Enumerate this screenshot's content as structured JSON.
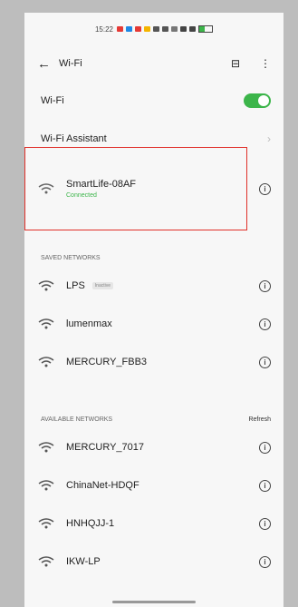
{
  "status_bar": {
    "time": "15:22"
  },
  "header": {
    "title": "Wi-Fi"
  },
  "wifi_toggle": {
    "label": "Wi-Fi",
    "on": true,
    "accent": "#3cb54a"
  },
  "assistant": {
    "label": "Wi-Fi Assistant"
  },
  "connected": {
    "name": "SmartLife-08AF",
    "status": "Connected"
  },
  "saved": {
    "title": "SAVED NETWORKS",
    "items": [
      {
        "name": "LPS",
        "tag": "Inactive"
      },
      {
        "name": "lumenmax",
        "tag": ""
      },
      {
        "name": "MERCURY_FBB3",
        "tag": ""
      }
    ]
  },
  "available": {
    "title": "AVAILABLE NETWORKS",
    "refresh": "Refresh",
    "items": [
      {
        "name": "MERCURY_7017"
      },
      {
        "name": "ChinaNet-HDQF"
      },
      {
        "name": "HNHQJJ-1"
      },
      {
        "name": "IKW-LP"
      }
    ]
  },
  "highlight_color": "#e0302a"
}
